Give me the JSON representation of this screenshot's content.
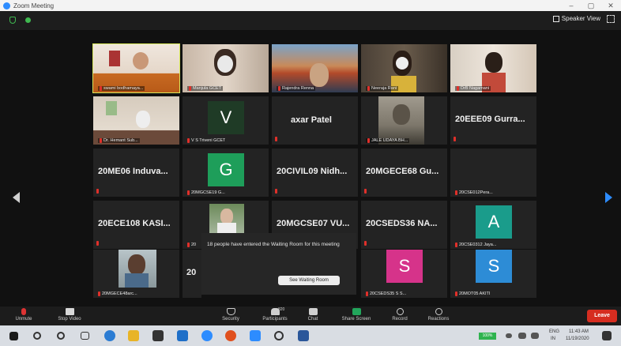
{
  "window": {
    "title": "Zoom Meeting",
    "min": "–",
    "max": "▢",
    "close": "✕"
  },
  "topbar": {
    "speaker_view": "Speaker View"
  },
  "tiles": [
    {
      "label": "swami bodhamaya...",
      "text": ""
    },
    {
      "label": "Manjula GCET",
      "text": ""
    },
    {
      "label": "Rajendra Renna",
      "text": ""
    },
    {
      "label": "Neeraja Rani",
      "text": ""
    },
    {
      "label": "DrB Nagamani",
      "text": ""
    },
    {
      "label": "Dr. Hemant Sub...",
      "text": ""
    },
    {
      "label": "V S Triveni GCET",
      "text": "",
      "avatar": "V"
    },
    {
      "label": "",
      "text": "axar Patel"
    },
    {
      "label": "JALE UDAYA BH...",
      "text": ""
    },
    {
      "label": "",
      "text": "20EEE09  Gurra..."
    },
    {
      "label": "",
      "text": "20ME06  Induva..."
    },
    {
      "label": "20MGCSE19 G...",
      "text": "",
      "avatar": "G"
    },
    {
      "label": "",
      "text": "20CIVIL09  Nidh..."
    },
    {
      "label": "",
      "text": "20MGECE68  Gu..."
    },
    {
      "label": "20CSE012Pera...",
      "text": ""
    },
    {
      "label": "",
      "text": "20ECE108  KASI..."
    },
    {
      "label": "20",
      "text": ""
    },
    {
      "label": "",
      "text": "20MGCSE07  VU..."
    },
    {
      "label": "",
      "text": "20CSEDS36  NA..."
    },
    {
      "label": "20CSE0312 Jaya...",
      "text": "",
      "avatar": "A"
    },
    {
      "label": "20MGECE48arc...",
      "text": ""
    },
    {
      "label": "",
      "text": "20"
    },
    {
      "label": "20CSEDS35 S S...",
      "text": "",
      "avatar": "S"
    },
    {
      "label": "20MOT05 AKITI",
      "text": "",
      "avatar": "S"
    }
  ],
  "waiting_room": {
    "message": "18 people have entered the Waiting Room for this meeting",
    "button": "See Waiting Room"
  },
  "toolbar": {
    "unmute": "Unmute",
    "stop_video": "Stop Video",
    "security": "Security",
    "participants": "Participants",
    "participants_count": "820",
    "chat": "Chat",
    "share_screen": "Share Screen",
    "record": "Record",
    "reactions": "Reactions",
    "leave": "Leave"
  },
  "taskbar": {
    "battery": "100%",
    "lang_top": "ENG",
    "lang_bottom": "IN",
    "time": "11:43 AM",
    "date": "11/19/2020"
  },
  "colors": {
    "accent": "#2d8cff",
    "share": "#22a55b",
    "leave": "#d62d20",
    "active_speaker": "#d6e65a",
    "avatar_v": "#1f3b26",
    "avatar_g": "#1e9e5a",
    "avatar_a": "#1a9c8b",
    "avatar_s_pink": "#d6338a",
    "avatar_s_blue": "#2d8cd6"
  }
}
